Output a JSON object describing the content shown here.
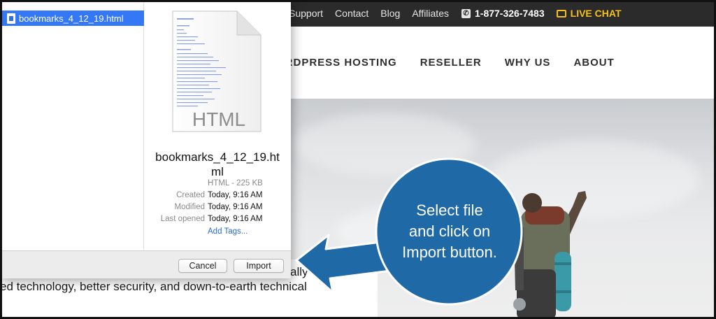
{
  "site": {
    "topbar": {
      "links": [
        "Support",
        "Contact",
        "Blog",
        "Affiliates"
      ],
      "phone": "1-877-326-7483",
      "live_chat": "LIVE CHAT"
    },
    "nav": [
      "ORDPRESS HOSTING",
      "RESELLER",
      "WHY US",
      "ABOUT"
    ],
    "hero_text": "ed technology, better security, and down-to-earth technical",
    "hero_text_tail": "ally"
  },
  "dialog": {
    "selected_file": "bookmarks_4_12_19.html",
    "preview": {
      "thumbnail_label": "HTML",
      "name": "bookmarks_4_12_19.html",
      "kind": "HTML - 225 KB",
      "meta": [
        {
          "label": "Created",
          "value": "Today, 9:16 AM"
        },
        {
          "label": "Modified",
          "value": "Today, 9:16 AM"
        },
        {
          "label": "Last opened",
          "value": "Today, 9:16 AM"
        }
      ],
      "add_tags": "Add Tags..."
    },
    "buttons": {
      "cancel": "Cancel",
      "import": "Import"
    }
  },
  "callout": {
    "lines": [
      "Select file",
      "and click on",
      "Import button."
    ],
    "color": "#1f6aa6"
  },
  "colors": {
    "topbar_bg": "#2b2b2b",
    "live_chat": "#f4c21a",
    "selection": "#3478f6",
    "link": "#2a6ad6"
  }
}
